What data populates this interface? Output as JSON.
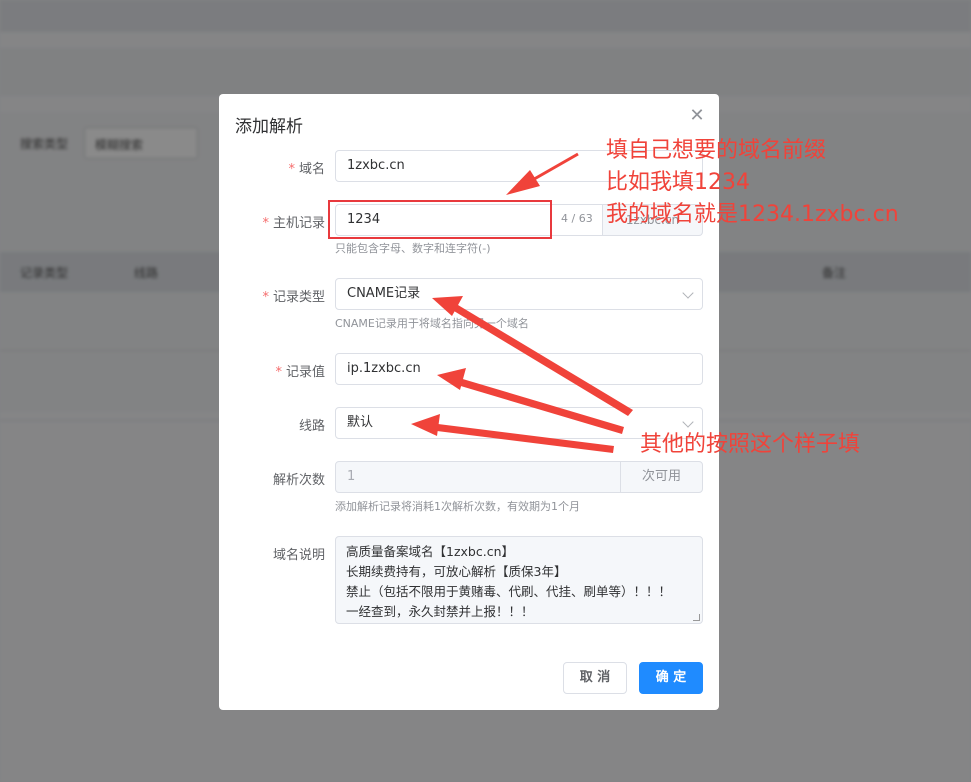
{
  "background": {
    "filter_label": "搜索类型",
    "filter_value": "模糊搜索",
    "table_headers": [
      "记录类型",
      "线路",
      "备注"
    ]
  },
  "dialog": {
    "title": "添加解析",
    "close_icon": "close-icon",
    "fields": {
      "domain": {
        "label": "域名",
        "value": "1zxbc.cn"
      },
      "host": {
        "label": "主机记录",
        "value": "1234",
        "counter": "4 / 63",
        "append": "1zxbc.cn",
        "hint": "只能包含字母、数字和连字符(-)"
      },
      "record_type": {
        "label": "记录类型",
        "value": "CNAME记录",
        "hint": "CNAME记录用于将域名指向另一个域名"
      },
      "record_value": {
        "label": "记录值",
        "value": "ip.1zxbc.cn"
      },
      "line": {
        "label": "线路",
        "value": "默认"
      },
      "times": {
        "label": "解析次数",
        "value": "1",
        "append": "次可用",
        "hint": "添加解析记录将消耗1次解析次数，有效期为1个月"
      },
      "description": {
        "label": "域名说明",
        "lines": [
          "高质量备案域名【1zxbc.cn】",
          "长期续费持有，可放心解析【质保3年】",
          "禁止（包括不限用于黄赌毒、代刷、代挂、刷单等）！！！",
          "一经查到，永久封禁并上报！！！"
        ]
      }
    },
    "buttons": {
      "cancel": "取 消",
      "ok": "确 定"
    }
  },
  "annotations": {
    "note1": [
      "填自己想要的域名前缀",
      "比如我填1234",
      "我的域名就是1234.1zxbc.cn"
    ],
    "note2": "其他的按照这个样子填",
    "color": "#f0433a"
  }
}
